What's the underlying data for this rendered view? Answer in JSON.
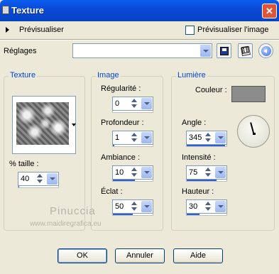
{
  "window": {
    "title": "Texture",
    "close_icon": "close-icon"
  },
  "preview": {
    "label": "Prévisualiser",
    "checkbox_label": "Prévisualiser l'image",
    "checkbox_checked": false
  },
  "presets": {
    "label": "Réglages",
    "value": ""
  },
  "groups": {
    "texture": {
      "title": "Texture",
      "size_label": "% taille :",
      "size_value": "40",
      "size_level": 0.02
    },
    "image": {
      "title": "Image",
      "regularity_label": "Régularité :",
      "regularity_value": "0",
      "regularity_level": 0.0,
      "depth_label": "Profondeur :",
      "depth_value": "1",
      "depth_level": 0.03,
      "ambiance_label": "Ambiance :",
      "ambiance_value": "10",
      "ambiance_level": 0.55,
      "shine_label": "Éclat :",
      "shine_value": "50",
      "shine_level": 0.5
    },
    "light": {
      "title": "Lumière",
      "color_label": "Couleur :",
      "color_value": "#8c8c8c",
      "angle_label": "Angle :",
      "angle_value": "345",
      "angle_level": 0.96,
      "intensity_label": "Intensité :",
      "intensity_value": "75",
      "intensity_level": 0.75,
      "height_label": "Hauteur :",
      "height_value": "30",
      "height_level": 0.33
    }
  },
  "watermark": {
    "name": "Pinuccia",
    "url": "www.maidiregrafica.eu"
  },
  "buttons": {
    "ok": "OK",
    "cancel": "Annuler",
    "help": "Aide"
  }
}
